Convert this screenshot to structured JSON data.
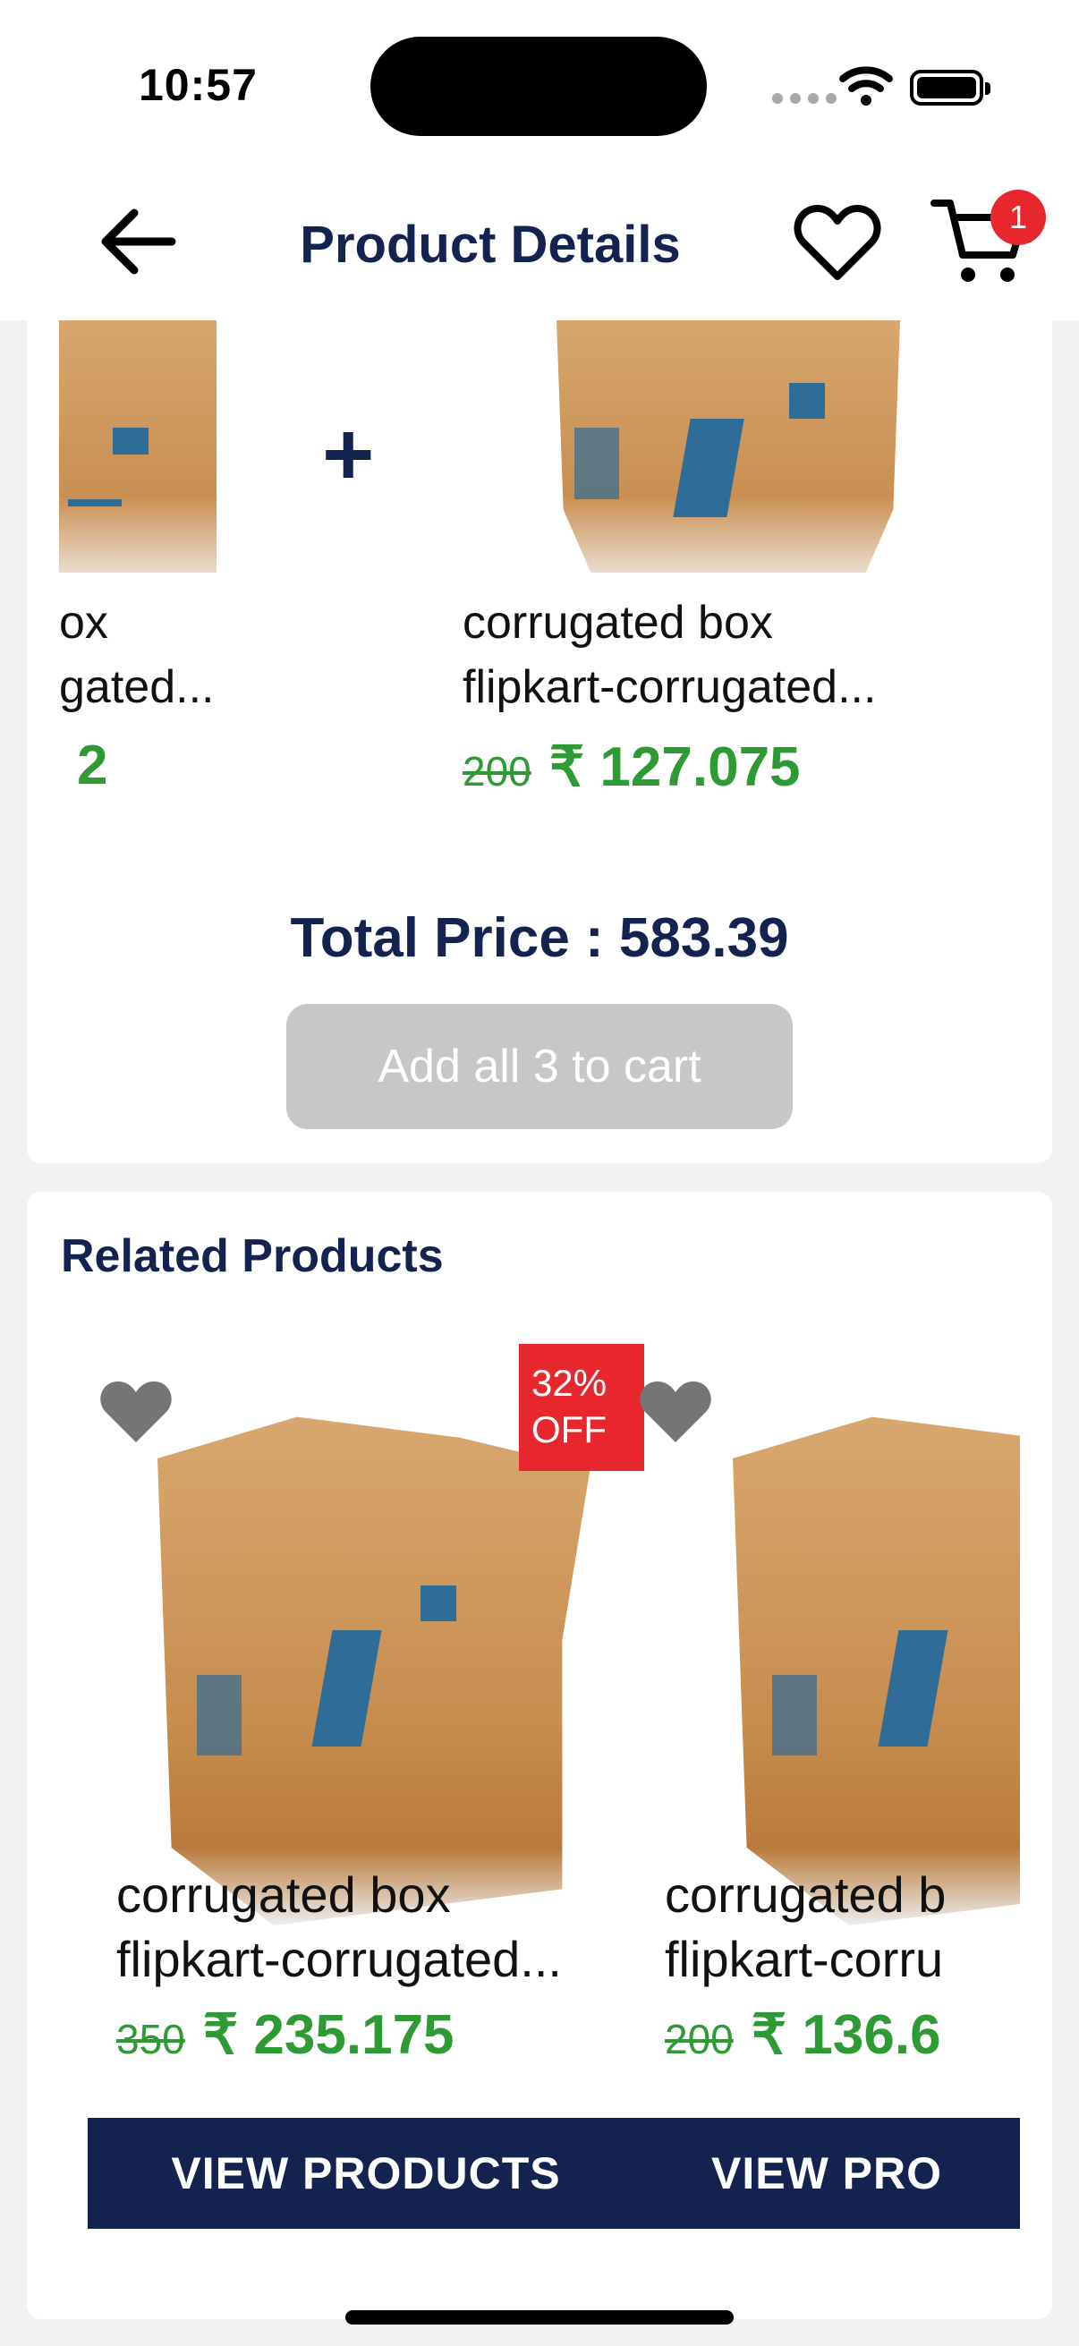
{
  "status_bar": {
    "time": "10:57"
  },
  "header": {
    "title": "Product Details",
    "cart_count": "1"
  },
  "bundle": {
    "items": [
      {
        "name_line1": "ox",
        "name_line2": "gated...",
        "old_price": "",
        "price": "2"
      },
      {
        "name_line1": "corrugated box",
        "name_line2": "flipkart-corrugated...",
        "old_price": "200",
        "price": "₹ 127.075"
      }
    ],
    "plus": "+",
    "total_label": "Total Price : 583.39",
    "add_all_label": "Add all 3 to cart"
  },
  "related": {
    "title": "Related Products",
    "products": [
      {
        "discount_line1": "32%",
        "discount_line2": "OFF",
        "name_line1": "corrugated box",
        "name_line2": "flipkart-corrugated...",
        "old_price": "350",
        "price": "₹ 235.175",
        "button": "VIEW PRODUCTS"
      },
      {
        "name_line1": "corrugated b",
        "name_line2": "flipkart-corru",
        "old_price": "200",
        "price": "₹ 136.6",
        "button": "VIEW PRO"
      }
    ]
  },
  "colors": {
    "navy": "#13224f",
    "green": "#2e9a33",
    "red": "#e8262d",
    "disabled": "#c7c7c7"
  }
}
